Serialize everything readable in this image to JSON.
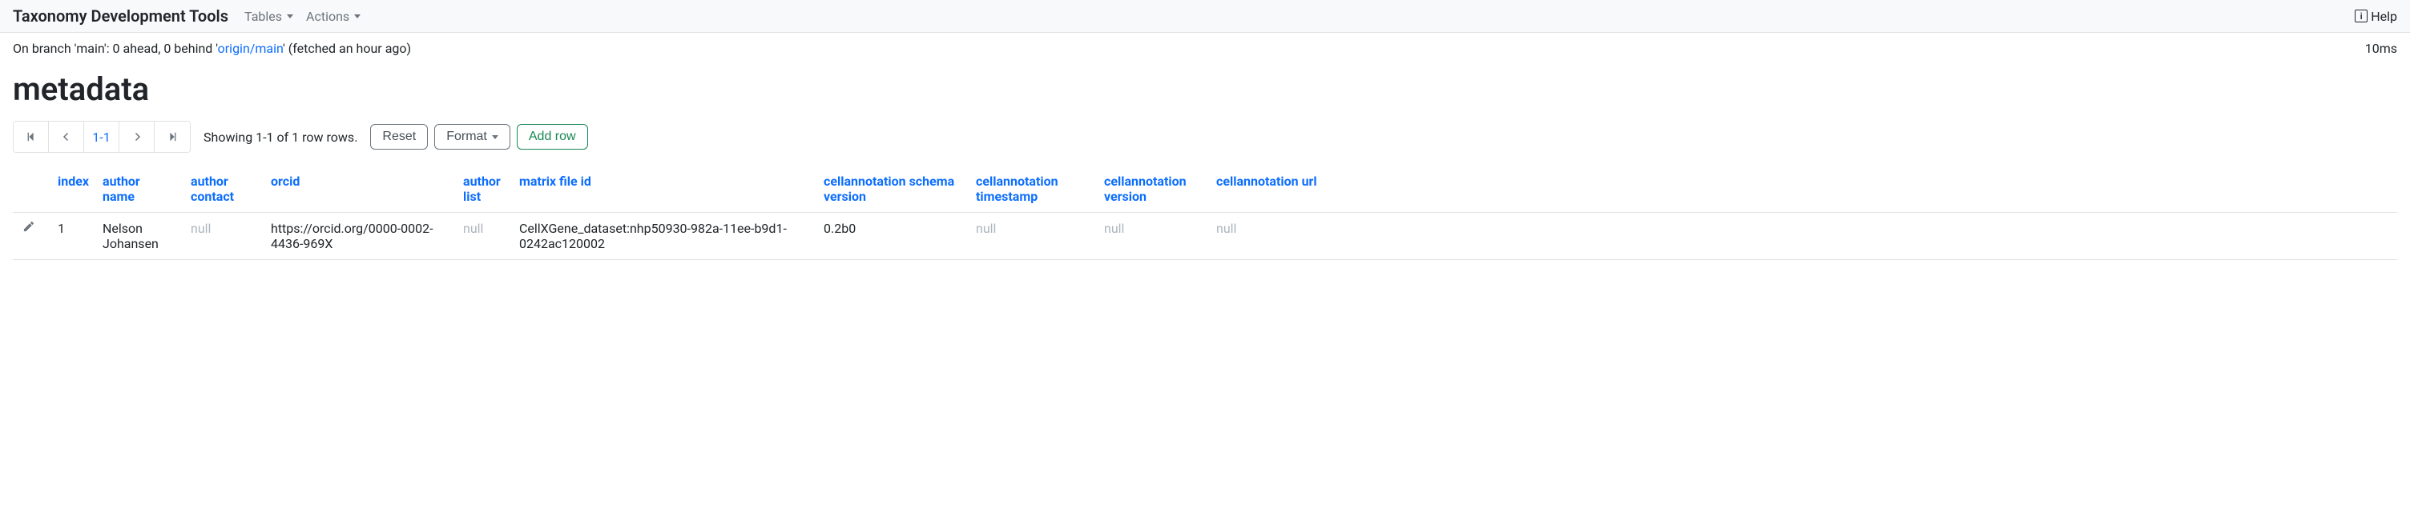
{
  "navbar": {
    "brand": "Taxonomy Development Tools",
    "menu": [
      {
        "label": "Tables"
      },
      {
        "label": "Actions"
      }
    ],
    "help_label": "Help"
  },
  "status": {
    "prefix": "On branch 'main': 0 ahead, 0 behind '",
    "link_text": "origin/main",
    "suffix": "' (fetched an hour ago)",
    "timing": "10ms"
  },
  "page_title": "metadata",
  "pagination": {
    "range": "1-1"
  },
  "showing_text": "Showing 1-1 of 1 row rows.",
  "buttons": {
    "reset": "Reset",
    "format": "Format",
    "add_row": "Add row"
  },
  "table": {
    "headers": {
      "index": "index",
      "author_name": "author name",
      "author_contact": "author contact",
      "orcid": "orcid",
      "author_list": "author list",
      "matrix_file_id": "matrix file id",
      "schema_version": "cellannotation schema version",
      "timestamp": "cellannotation timestamp",
      "version": "cellannotation version",
      "url": "cellannotation url"
    },
    "rows": [
      {
        "index": "1",
        "author_name": "Nelson Johansen",
        "author_contact": "null",
        "orcid": "https://orcid.org/0000-0002-4436-969X",
        "author_list": "null",
        "matrix_file_id": "CellXGene_dataset:nhp50930-982a-11ee-b9d1-0242ac120002",
        "schema_version": "0.2b0",
        "timestamp": "null",
        "version": "null",
        "url": "null"
      }
    ]
  }
}
